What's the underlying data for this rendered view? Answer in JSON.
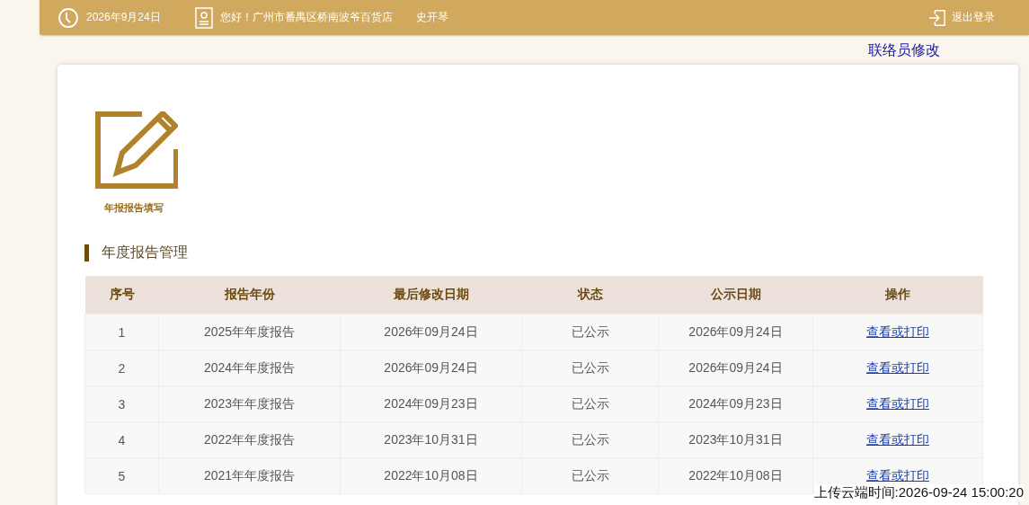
{
  "header": {
    "date": "2026年9月24日",
    "greeting": "您好！广州市番禺区桥南波爷百货店",
    "user": "史开琴",
    "logout": "退出登录"
  },
  "contact_link": "联络员修改",
  "tile": {
    "label": "年报报告填写"
  },
  "section_title": "年度报告管理",
  "table": {
    "columns": [
      "序号",
      "报告年份",
      "最后修改日期",
      "状态",
      "公示日期",
      "操作"
    ],
    "rows": [
      [
        "1",
        "2025年年度报告",
        "2026年09月24日",
        "已公示",
        "2026年09月24日",
        "查看或打印"
      ],
      [
        "2",
        "2024年年度报告",
        "2026年09月24日",
        "已公示",
        "2026年09月24日",
        "查看或打印"
      ],
      [
        "3",
        "2023年年度报告",
        "2024年09月23日",
        "已公示",
        "2024年09月23日",
        "查看或打印"
      ],
      [
        "4",
        "2022年年度报告",
        "2023年10月31日",
        "已公示",
        "2023年10月31日",
        "查看或打印"
      ],
      [
        "5",
        "2021年年度报告",
        "2022年10月08日",
        "已公示",
        "2022年10月08日",
        "查看或打印"
      ]
    ]
  },
  "upload_time": "上传云端时间:2026-09-24 15:00:20"
}
